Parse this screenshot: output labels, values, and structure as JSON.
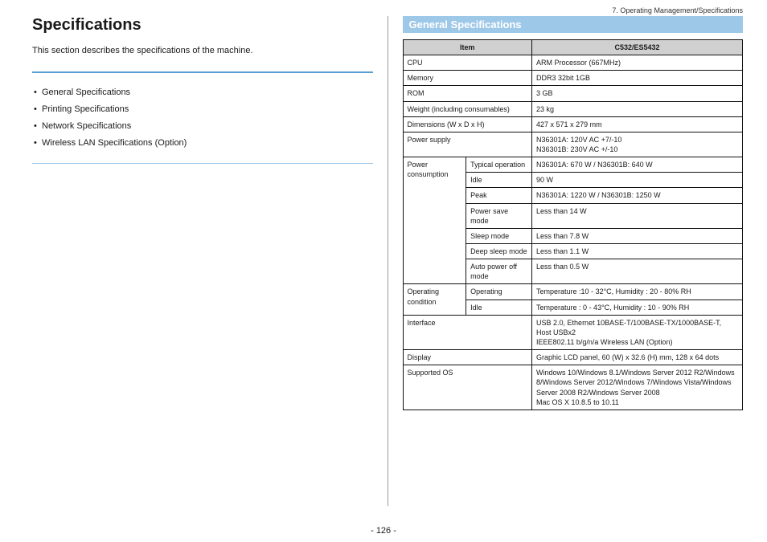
{
  "breadcrumb": "7. Operating Management/Specifications",
  "title": "Specifications",
  "intro": "This section describes the specifications of the machine.",
  "toc": [
    "General Specifications",
    "Printing Specifications",
    "Network Specifications",
    "Wireless LAN Specifications (Option)"
  ],
  "section_title": "General Specifications",
  "table": {
    "head_item": "Item",
    "head_model": "C532/ES5432",
    "rows": [
      {
        "item": "CPU",
        "sub": "",
        "value": "ARM Processor (667MHz)"
      },
      {
        "item": "Memory",
        "sub": "",
        "value": "DDR3 32bit 1GB"
      },
      {
        "item": "ROM",
        "sub": "",
        "value": "3 GB"
      },
      {
        "item": "Weight (including consumables)",
        "sub": "",
        "value": "23 kg"
      },
      {
        "item": "Dimensions (W x D x H)",
        "sub": "",
        "value": "427 x 571 x 279 mm"
      },
      {
        "item": "Power supply",
        "sub": "",
        "value": "N36301A: 120V AC +7/-10\nN36301B: 230V AC +/-10"
      },
      {
        "item": "Power consumption",
        "sub": "Typical operation",
        "value": "N36301A: 670 W / N36301B: 640 W",
        "rowspan": 7
      },
      {
        "item": "",
        "sub": "Idle",
        "value": "90 W"
      },
      {
        "item": "",
        "sub": "Peak",
        "value": "N36301A: 1220 W / N36301B: 1250 W"
      },
      {
        "item": "",
        "sub": "Power save mode",
        "value": "Less than 14 W"
      },
      {
        "item": "",
        "sub": "Sleep mode",
        "value": "Less than 7.8 W"
      },
      {
        "item": "",
        "sub": "Deep sleep mode",
        "value": "Less than 1.1 W"
      },
      {
        "item": "",
        "sub": "Auto power off mode",
        "value": "Less than 0.5 W"
      },
      {
        "item": "Operating condition",
        "sub": "Operating",
        "value": "Temperature :10 - 32°C, Humidity : 20 - 80% RH",
        "rowspan": 2
      },
      {
        "item": "",
        "sub": "Idle",
        "value": "Temperature : 0 - 43°C, Humidity : 10 - 90% RH"
      },
      {
        "item": "Interface",
        "sub": "",
        "value": "USB 2.0, Ethernet 10BASE-T/100BASE-TX/1000BASE-T, Host USBx2\nIEEE802.11 b/g/n/a Wireless LAN (Option)"
      },
      {
        "item": "Display",
        "sub": "",
        "value": "Graphic LCD panel, 60 (W) x 32.6 (H) mm, 128 x 64 dots"
      },
      {
        "item": "Supported OS",
        "sub": "",
        "value": "Windows 10/Windows 8.1/Windows Server 2012 R2/Windows 8/Windows Server 2012/Windows 7/Windows Vista/Windows Server 2008 R2/Windows Server 2008\nMac OS X 10.8.5 to 10.11"
      }
    ]
  },
  "page_number": "- 126 -"
}
